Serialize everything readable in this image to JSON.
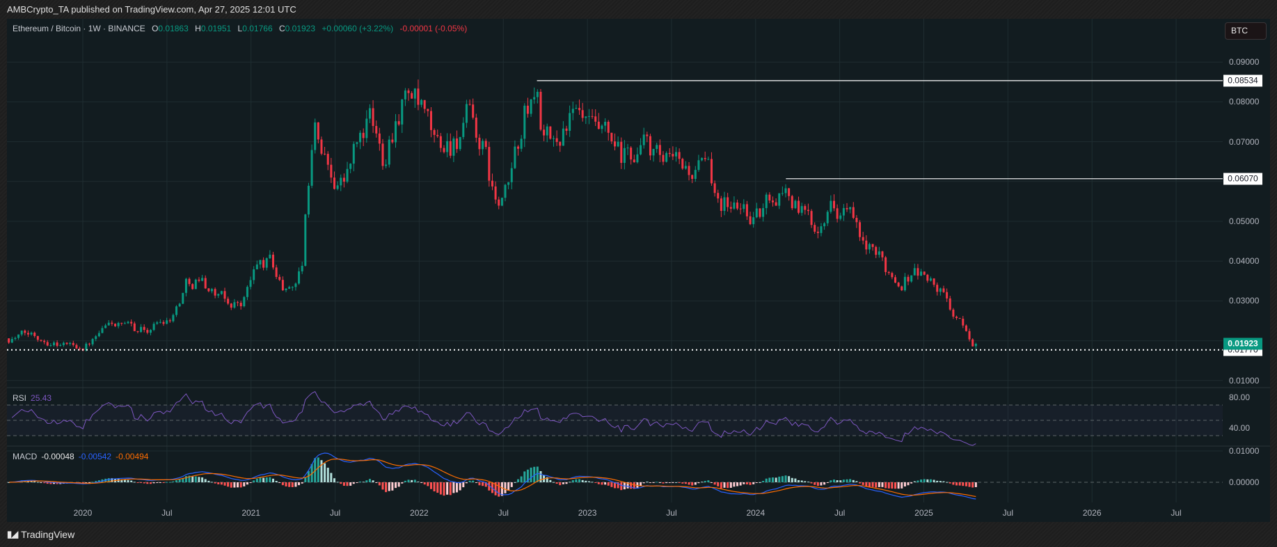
{
  "header": {
    "published": "AMBCrypto_TA published on TradingView.com, Apr 27, 2025 12:01 UTC"
  },
  "legend": {
    "symbol": "Ethereum / Bitcoin · 1W · BINANCE",
    "o_label": "O",
    "o_value": "0.01863",
    "h_label": "H",
    "h_value": "0.01951",
    "l_label": "L",
    "l_value": "0.01766",
    "c_label": "C",
    "c_value": "0.01923",
    "change": "+0.00060 (+3.22%)",
    "change2": "-0.00001 (-0.05%)"
  },
  "currency_button": "BTC",
  "indicators": {
    "rsi": {
      "label": "RSI",
      "value": "25.43"
    },
    "macd": {
      "label": "MACD",
      "hist": "-0.00048",
      "macd": "-0.00542",
      "signal": "-0.00494"
    }
  },
  "footer": {
    "logo": "17",
    "brand": "TradingView"
  },
  "colors": {
    "up": "#089981",
    "down": "#f23645",
    "rsi": "#7e57c2",
    "macd": "#2962ff",
    "signal": "#ff6d00",
    "hist_up_strong": "#26a69a",
    "hist_up_weak": "#b2dfdb",
    "hist_down_strong": "#ff5252",
    "hist_down_weak": "#ffcdd2"
  },
  "chart_data": {
    "type": "candlestick",
    "title": "Ethereum / Bitcoin · 1W · BINANCE",
    "interval": "1W",
    "last_ohlc": {
      "open": 0.01863,
      "high": 0.01951,
      "low": 0.01766,
      "close": 0.01923
    },
    "approx_close_path": [
      [
        2019.56,
        0.0206
      ],
      [
        2019.7,
        0.0216
      ],
      [
        2019.85,
        0.0196
      ],
      [
        2020.0,
        0.0186
      ],
      [
        2020.08,
        0.0205
      ],
      [
        2020.17,
        0.0245
      ],
      [
        2020.25,
        0.023
      ],
      [
        2020.38,
        0.0227
      ],
      [
        2020.46,
        0.025
      ],
      [
        2020.54,
        0.027
      ],
      [
        2020.62,
        0.035
      ],
      [
        2020.7,
        0.036
      ],
      [
        2020.78,
        0.032
      ],
      [
        2020.87,
        0.029
      ],
      [
        2020.95,
        0.03
      ],
      [
        2021.04,
        0.039
      ],
      [
        2021.12,
        0.04
      ],
      [
        2021.2,
        0.032
      ],
      [
        2021.3,
        0.038
      ],
      [
        2021.37,
        0.075
      ],
      [
        2021.45,
        0.064
      ],
      [
        2021.55,
        0.06
      ],
      [
        2021.62,
        0.068
      ],
      [
        2021.7,
        0.075
      ],
      [
        2021.78,
        0.066
      ],
      [
        2021.87,
        0.079
      ],
      [
        2021.94,
        0.083
      ],
      [
        2022.02,
        0.075
      ],
      [
        2022.1,
        0.068
      ],
      [
        2022.2,
        0.07
      ],
      [
        2022.28,
        0.075
      ],
      [
        2022.37,
        0.069
      ],
      [
        2022.46,
        0.053
      ],
      [
        2022.52,
        0.056
      ],
      [
        2022.62,
        0.076
      ],
      [
        2022.7,
        0.082
      ],
      [
        2022.74,
        0.07
      ],
      [
        2022.8,
        0.068
      ],
      [
        2022.88,
        0.076
      ],
      [
        2022.96,
        0.074
      ],
      [
        2023.04,
        0.07
      ],
      [
        2023.12,
        0.069
      ],
      [
        2023.2,
        0.064
      ],
      [
        2023.28,
        0.067
      ],
      [
        2023.36,
        0.069
      ],
      [
        2023.44,
        0.063
      ],
      [
        2023.55,
        0.063
      ],
      [
        2023.7,
        0.062
      ],
      [
        2023.78,
        0.057
      ],
      [
        2023.86,
        0.054
      ],
      [
        2023.94,
        0.053
      ],
      [
        2024.02,
        0.051
      ],
      [
        2024.1,
        0.057
      ],
      [
        2024.18,
        0.059
      ],
      [
        2024.25,
        0.053
      ],
      [
        2024.36,
        0.048
      ],
      [
        2024.4,
        0.055
      ],
      [
        2024.5,
        0.054
      ],
      [
        2024.56,
        0.052
      ],
      [
        2024.62,
        0.044
      ],
      [
        2024.7,
        0.041
      ],
      [
        2024.78,
        0.038
      ],
      [
        2024.86,
        0.035
      ],
      [
        2024.94,
        0.038
      ],
      [
        2025.02,
        0.036
      ],
      [
        2025.12,
        0.031
      ],
      [
        2025.2,
        0.025
      ],
      [
        2025.3,
        0.01923
      ]
    ],
    "horizontal_levels": [
      {
        "value": 0.08534,
        "label": "0.08534",
        "from": 2022.7
      },
      {
        "value": 0.0607,
        "label": "0.06070",
        "from": 2024.18
      }
    ],
    "dotted_level": {
      "value": 0.0177,
      "label": "0.01770"
    },
    "last_price_label": "0.01923",
    "price_axis": {
      "ticks": [
        "0.09000",
        "0.08000",
        "0.07000",
        "0.05000",
        "0.04000",
        "0.03000",
        "0.01000"
      ],
      "range": [
        0.0,
        0.0985
      ]
    },
    "rsi_axis": {
      "ticks": [
        "80.00",
        "40.00"
      ],
      "bands": [
        70,
        50,
        30
      ],
      "period": 14
    },
    "macd_axis": {
      "ticks": [
        "0.01000",
        "0.00000"
      ],
      "params": [
        12,
        26,
        9
      ]
    },
    "time_axis": {
      "ticks": [
        {
          "label": "2020",
          "t": 2020.0
        },
        {
          "label": "Jul",
          "t": 2020.5
        },
        {
          "label": "2021",
          "t": 2021.0
        },
        {
          "label": "Jul",
          "t": 2021.5
        },
        {
          "label": "2022",
          "t": 2022.0
        },
        {
          "label": "Jul",
          "t": 2022.5
        },
        {
          "label": "2023",
          "t": 2023.0
        },
        {
          "label": "Jul",
          "t": 2023.5
        },
        {
          "label": "2024",
          "t": 2024.0
        },
        {
          "label": "Jul",
          "t": 2024.5
        },
        {
          "label": "2025",
          "t": 2025.0
        },
        {
          "label": "Jul",
          "t": 2025.5
        },
        {
          "label": "2026",
          "t": 2026.0
        },
        {
          "label": "Jul",
          "t": 2026.5
        }
      ]
    },
    "grid": true
  }
}
